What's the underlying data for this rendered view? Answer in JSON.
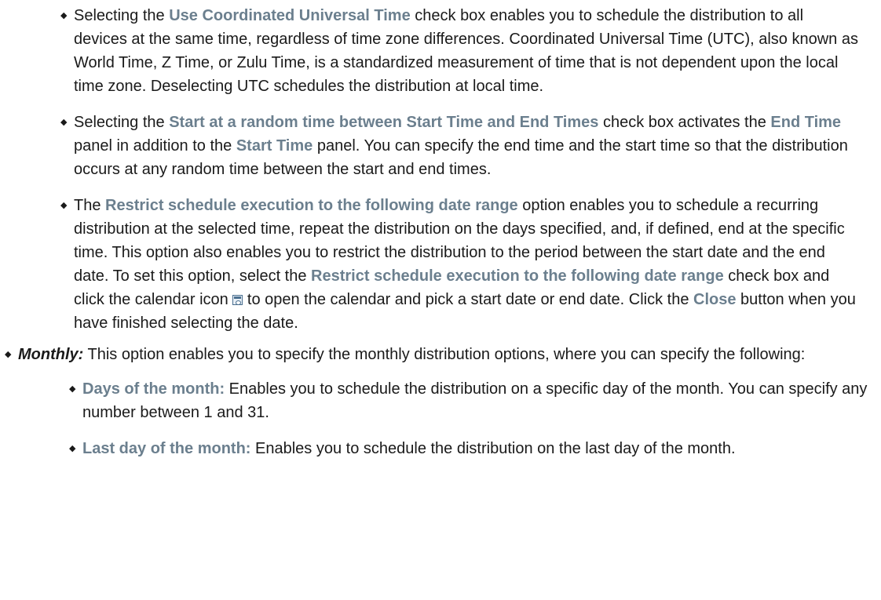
{
  "bullet_char": "◆",
  "utc_item": {
    "pre": "Selecting the ",
    "ui": "Use Coordinated Universal Time",
    "post": " check box enables you to schedule the distribution to all devices at the same time, regardless of time zone differences. Coordinated Universal Time (UTC), also known as World Time, Z Time, or Zulu Time, is a standardized measurement of time that is not dependent upon the local time zone. Deselecting UTC schedules the distribution at local time."
  },
  "random_item": {
    "pre": "Selecting the ",
    "ui1": "Start at a random time between Start Time and End Times",
    "mid1": " check box activates the ",
    "ui2": "End Time",
    "mid2": " panel in addition to the ",
    "ui3": "Start Time",
    "post": " panel. You can specify the end time and the start time so that the distribution occurs at any random time between the start and end times."
  },
  "restrict_item": {
    "pre": "The ",
    "ui1": "Restrict schedule execution to the following date range",
    "mid1": " option enables you to schedule a recurring distribution at the selected time, repeat the distribution on the days specified, and, if defined, end at the specific time. This option also enables you to restrict the distribution to the period between the start date and the end date. To set this option, select the ",
    "ui2": "Restrict schedule execution to the following date range",
    "mid2": " check box and click the calendar icon ",
    "mid3": " to open the calendar and pick a start date or end date. Click the ",
    "ui3": "Close",
    "post": " button when you have finished selecting the date."
  },
  "monthly_item": {
    "term": "Monthly:",
    "text": " This option enables you to specify the monthly distribution options, where you can specify the following:"
  },
  "monthly_subitems": [
    {
      "ui": "Days of the month:",
      "text": " Enables you to schedule the distribution on a specific day of the month. You can specify any number between 1 and 31."
    },
    {
      "ui": "Last day of the month:",
      "text": " Enables you to schedule the distribution on the last day of the month."
    }
  ]
}
